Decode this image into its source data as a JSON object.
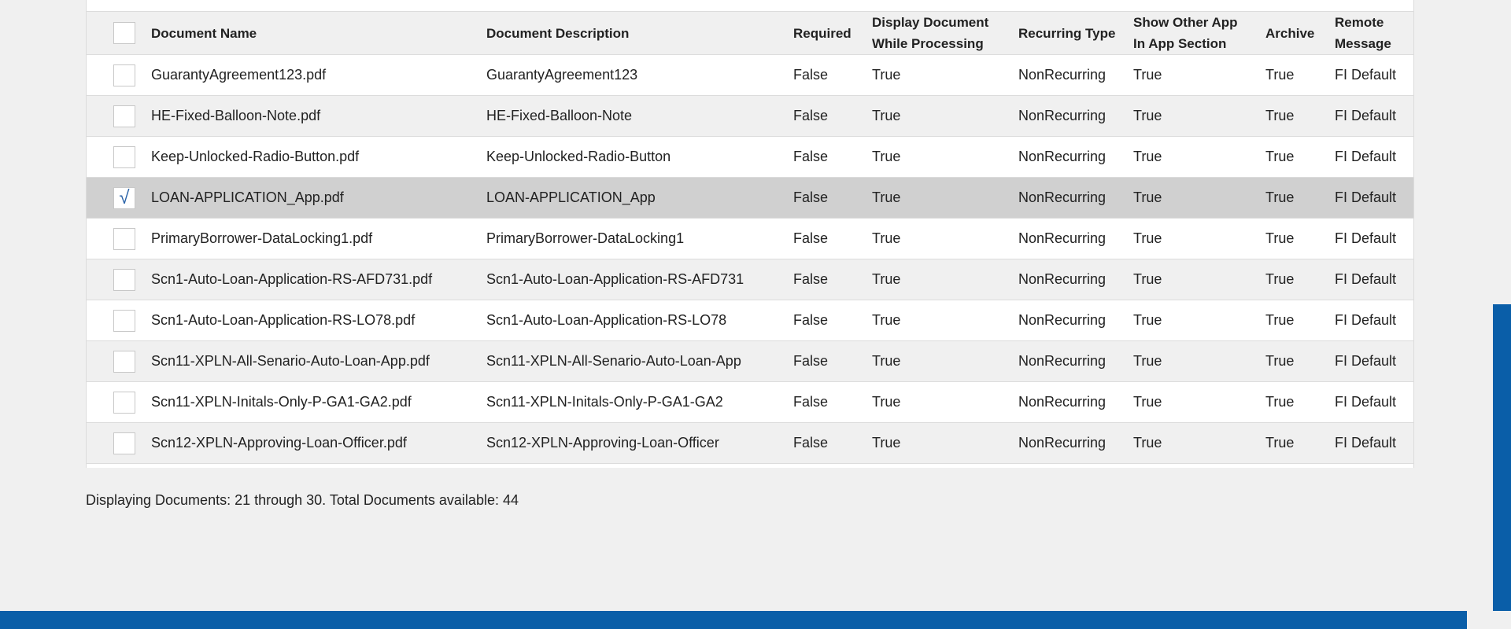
{
  "table": {
    "headers": {
      "name": "Document Name",
      "description": "Document Description",
      "required": "Required",
      "display": "Display Document While Processing",
      "recurring": "Recurring Type",
      "show_other": "Show Other App In App Section",
      "archive": "Archive",
      "remote": "Remote Message"
    },
    "rows": [
      {
        "name": "GuarantyAgreement123.pdf",
        "description": "GuarantyAgreement123",
        "required": "False",
        "display": "True",
        "recurring": "NonRecurring",
        "show_other": "True",
        "archive": "True",
        "remote": "FI Default",
        "checked": false
      },
      {
        "name": "HE-Fixed-Balloon-Note.pdf",
        "description": "HE-Fixed-Balloon-Note",
        "required": "False",
        "display": "True",
        "recurring": "NonRecurring",
        "show_other": "True",
        "archive": "True",
        "remote": "FI Default",
        "checked": false
      },
      {
        "name": "Keep-Unlocked-Radio-Button.pdf",
        "description": "Keep-Unlocked-Radio-Button",
        "required": "False",
        "display": "True",
        "recurring": "NonRecurring",
        "show_other": "True",
        "archive": "True",
        "remote": "FI Default",
        "checked": false
      },
      {
        "name": "LOAN-APPLICATION_App.pdf",
        "description": "LOAN-APPLICATION_App",
        "required": "False",
        "display": "True",
        "recurring": "NonRecurring",
        "show_other": "True",
        "archive": "True",
        "remote": "FI Default",
        "checked": true
      },
      {
        "name": "PrimaryBorrower-DataLocking1.pdf",
        "description": "PrimaryBorrower-DataLocking1",
        "required": "False",
        "display": "True",
        "recurring": "NonRecurring",
        "show_other": "True",
        "archive": "True",
        "remote": "FI Default",
        "checked": false
      },
      {
        "name": "Scn1-Auto-Loan-Application-RS-AFD731.pdf",
        "description": "Scn1-Auto-Loan-Application-RS-AFD731",
        "required": "False",
        "display": "True",
        "recurring": "NonRecurring",
        "show_other": "True",
        "archive": "True",
        "remote": "FI Default",
        "checked": false
      },
      {
        "name": "Scn1-Auto-Loan-Application-RS-LO78.pdf",
        "description": "Scn1-Auto-Loan-Application-RS-LO78",
        "required": "False",
        "display": "True",
        "recurring": "NonRecurring",
        "show_other": "True",
        "archive": "True",
        "remote": "FI Default",
        "checked": false
      },
      {
        "name": "Scn11-XPLN-All-Senario-Auto-Loan-App.pdf",
        "description": "Scn11-XPLN-All-Senario-Auto-Loan-App",
        "required": "False",
        "display": "True",
        "recurring": "NonRecurring",
        "show_other": "True",
        "archive": "True",
        "remote": "FI Default",
        "checked": false
      },
      {
        "name": "Scn11-XPLN-Initals-Only-P-GA1-GA2.pdf",
        "description": "Scn11-XPLN-Initals-Only-P-GA1-GA2",
        "required": "False",
        "display": "True",
        "recurring": "NonRecurring",
        "show_other": "True",
        "archive": "True",
        "remote": "FI Default",
        "checked": false
      },
      {
        "name": "Scn12-XPLN-Approving-Loan-Officer.pdf",
        "description": "Scn12-XPLN-Approving-Loan-Officer",
        "required": "False",
        "display": "True",
        "recurring": "NonRecurring",
        "show_other": "True",
        "archive": "True",
        "remote": "FI Default",
        "checked": false
      }
    ]
  },
  "footer": {
    "summary": "Displaying Documents: 21 through 30. Total Documents available: 44"
  },
  "colors": {
    "accent": "#0a5ea8",
    "selected_row": "#d0d0d0",
    "stripe": "#f0f0f0"
  },
  "icons": {
    "checkmark": "check-icon"
  }
}
